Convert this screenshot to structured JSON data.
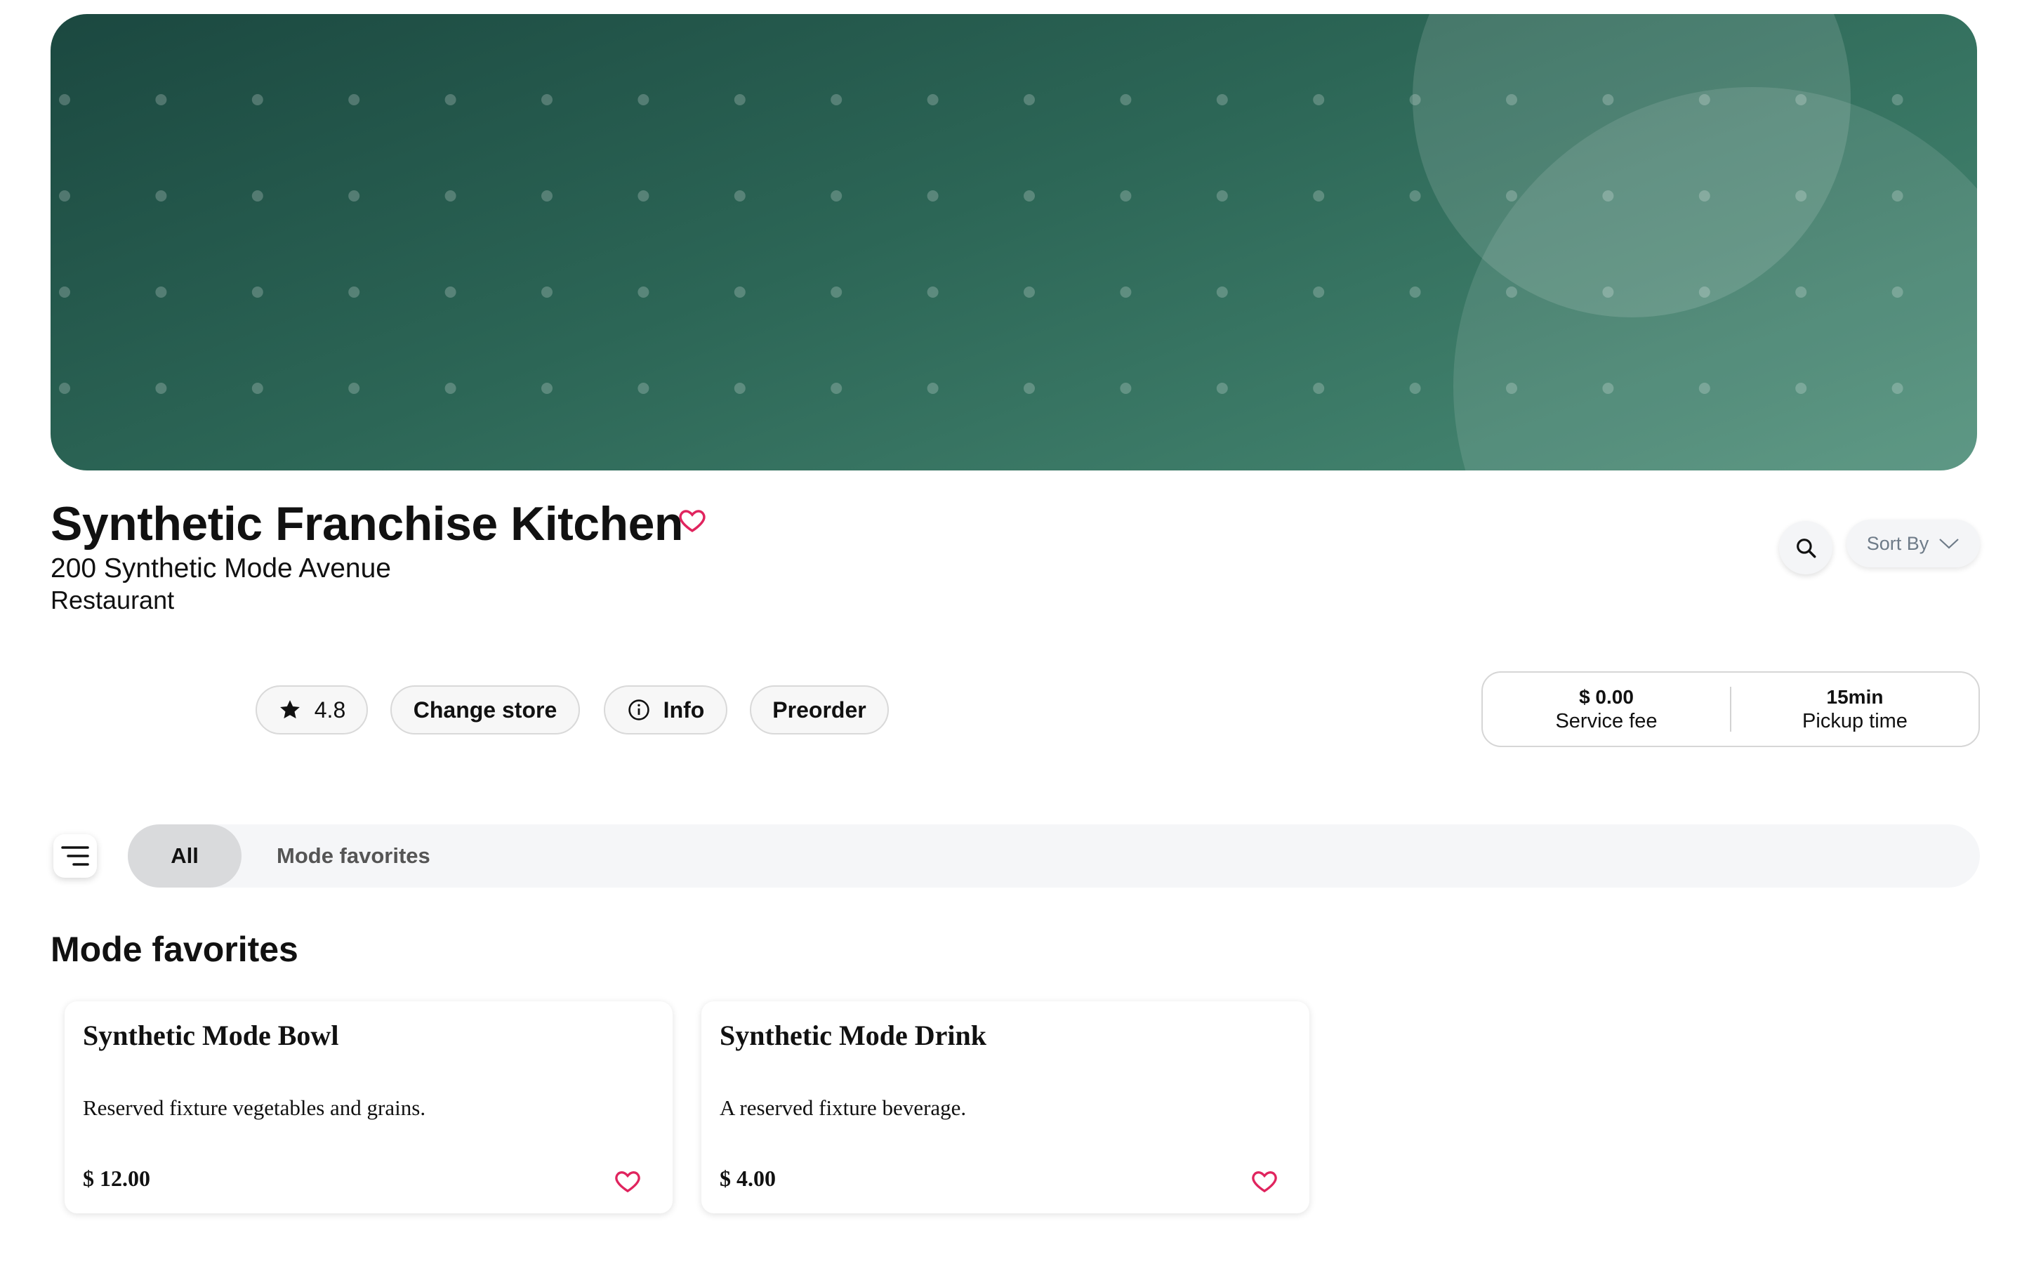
{
  "store": {
    "name": "Synthetic Franchise Kitchen",
    "address": "200 Synthetic Mode Avenue",
    "type": "Restaurant"
  },
  "header_actions": {
    "sort_label": "Sort By"
  },
  "action_pills": {
    "rating": "4.8",
    "change_store": "Change store",
    "info": "Info",
    "preorder": "Preorder"
  },
  "fees": {
    "service_fee_value": "$ 0.00",
    "service_fee_label": "Service fee",
    "pickup_value": "15min",
    "pickup_label": "Pickup time"
  },
  "tabs": [
    {
      "label": "All",
      "active": true
    },
    {
      "label": "Mode favorites",
      "active": false
    }
  ],
  "section": {
    "title": "Mode favorites"
  },
  "items": [
    {
      "name": "Synthetic Mode Bowl",
      "description": "Reserved fixture vegetables and grains.",
      "price": "$ 12.00"
    },
    {
      "name": "Synthetic Mode Drink",
      "description": "A reserved fixture beverage.",
      "price": "$ 4.00"
    }
  ],
  "colors": {
    "banner_dark": "#1b4840",
    "banner_light": "#4a8c76",
    "heart": "#e0245e"
  },
  "icons": [
    "heart-icon",
    "search-icon",
    "chevron-down-icon",
    "star-icon",
    "info-icon",
    "menu-icon"
  ]
}
